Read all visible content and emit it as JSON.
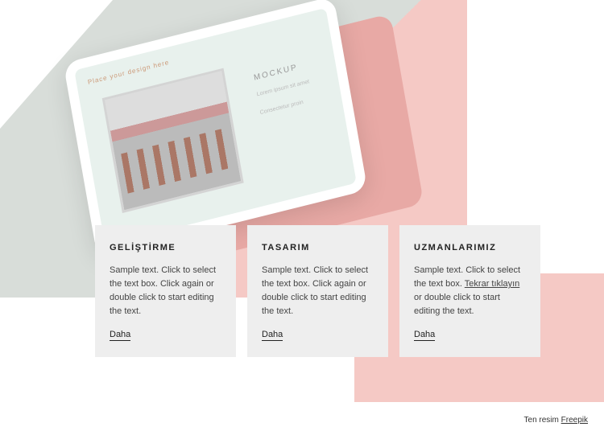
{
  "hero": {
    "tablet": {
      "placeholder": "Place your design here",
      "heading": "MOCKUP",
      "line1": "Lorem ipsum sit amet",
      "line2": "Consectetur proin"
    }
  },
  "cards": [
    {
      "title": "GELİŞTİRME",
      "body": "Sample text. Click to select the text box. Click again or double click to start editing the text.",
      "link": "Daha"
    },
    {
      "title": "TASARIM",
      "body": "Sample text. Click to select the text box. Click again or double click to start editing the text.",
      "link": "Daha"
    },
    {
      "title": "UZMANLARIMIZ",
      "body_prefix": "Sample text. Click to select the text box. ",
      "body_link": "Tekrar tıklayın",
      "body_suffix": " or double click to start editing the text.",
      "link": "Daha"
    }
  ],
  "credit": {
    "prefix": "Ten resim ",
    "source": "Freepik"
  }
}
